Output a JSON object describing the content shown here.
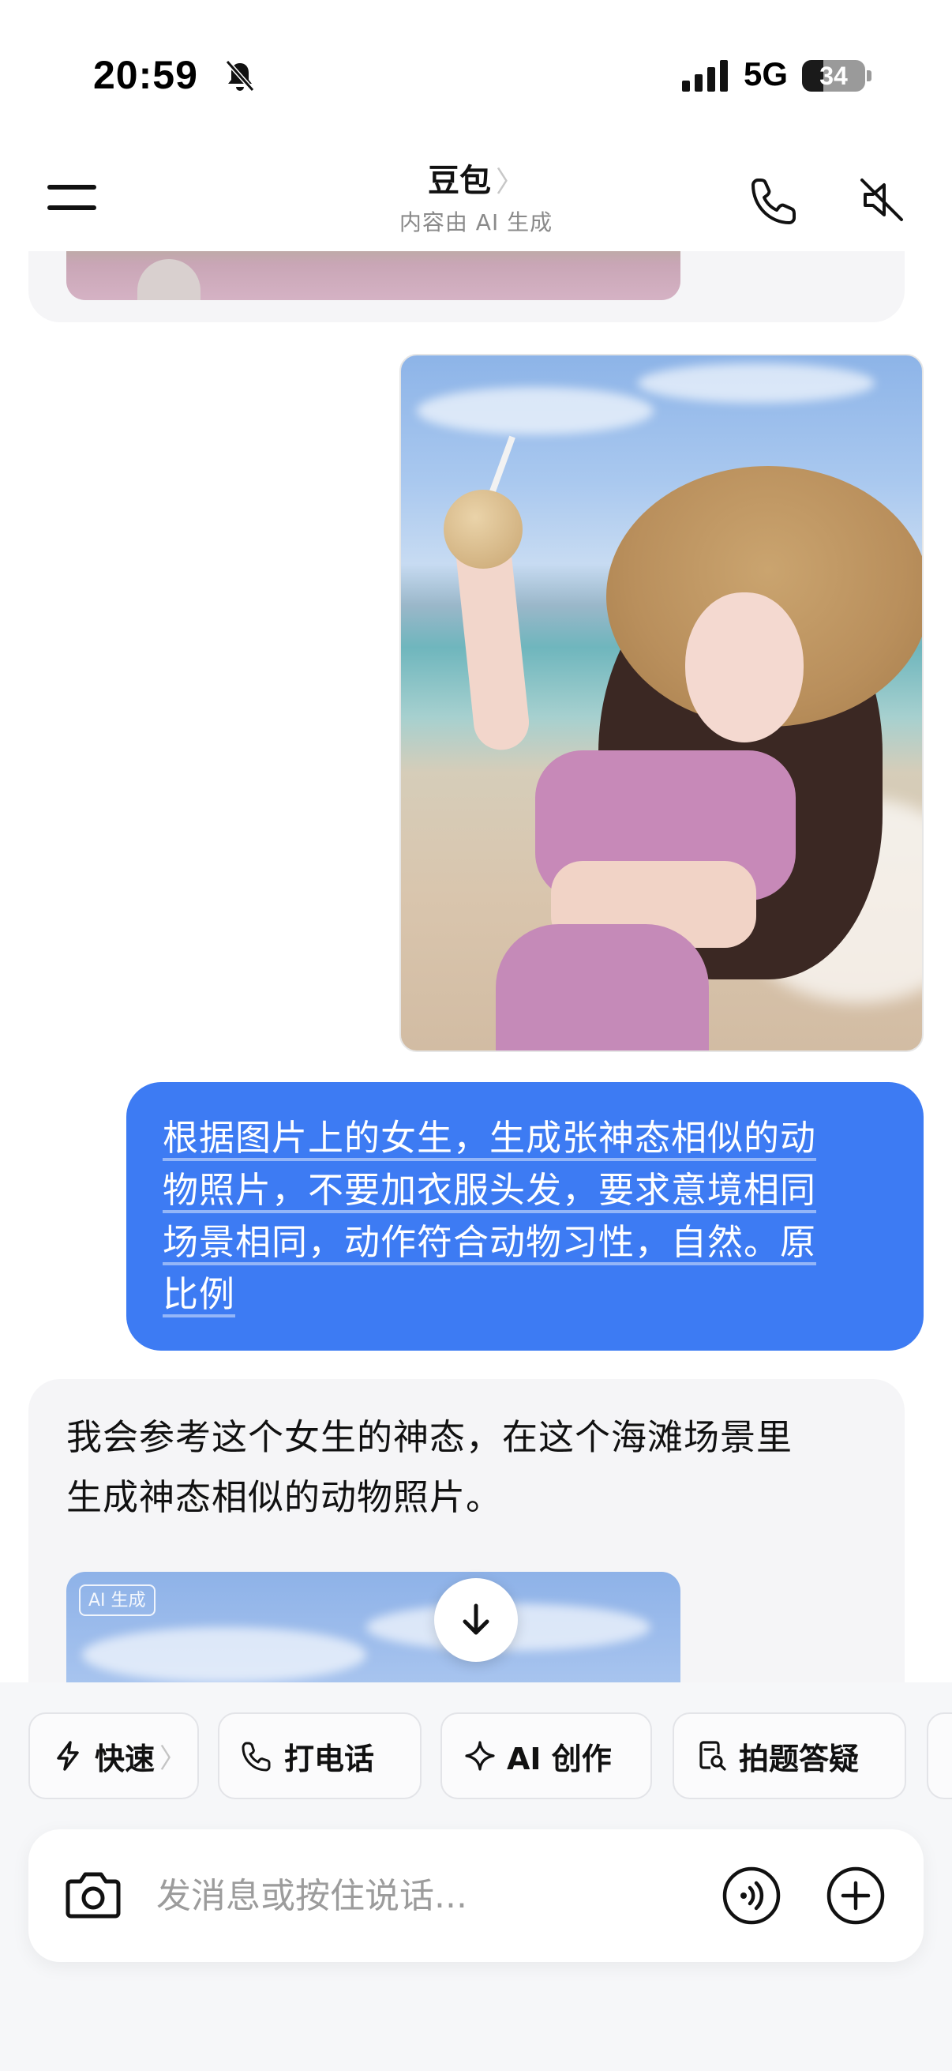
{
  "status_bar": {
    "time": "20:59",
    "network": "5G",
    "battery": "34",
    "battery_level": 0.34
  },
  "header": {
    "title": "豆包",
    "subtitle": "内容由 AI 生成"
  },
  "messages": {
    "user_text": [
      "根据图片上的女生，生成张神态相似的动",
      "物照片，不要加衣服头发，要求意境相同",
      "场景相同，动作符合动物习性，自然。原",
      "比例"
    ],
    "ai_reply": [
      "我会参考这个女生的神态，在这个海滩场景里",
      "生成神态相似的动物照片。"
    ],
    "ai_badge": "AI 生成"
  },
  "quick_actions": [
    {
      "label": "快速",
      "icon": "lightning-icon",
      "arrow": "〉"
    },
    {
      "label": "打电话",
      "icon": "phone-icon"
    },
    {
      "label": "AI 创作",
      "icon": "sparkle-icon"
    },
    {
      "label": "拍题答疑",
      "icon": "document-search-icon"
    }
  ],
  "input": {
    "placeholder": "发消息或按住说话..."
  },
  "colors": {
    "user_bubble": "#3d7bf3",
    "ai_card": "#f5f5f7",
    "panel": "#f6f7f9"
  }
}
